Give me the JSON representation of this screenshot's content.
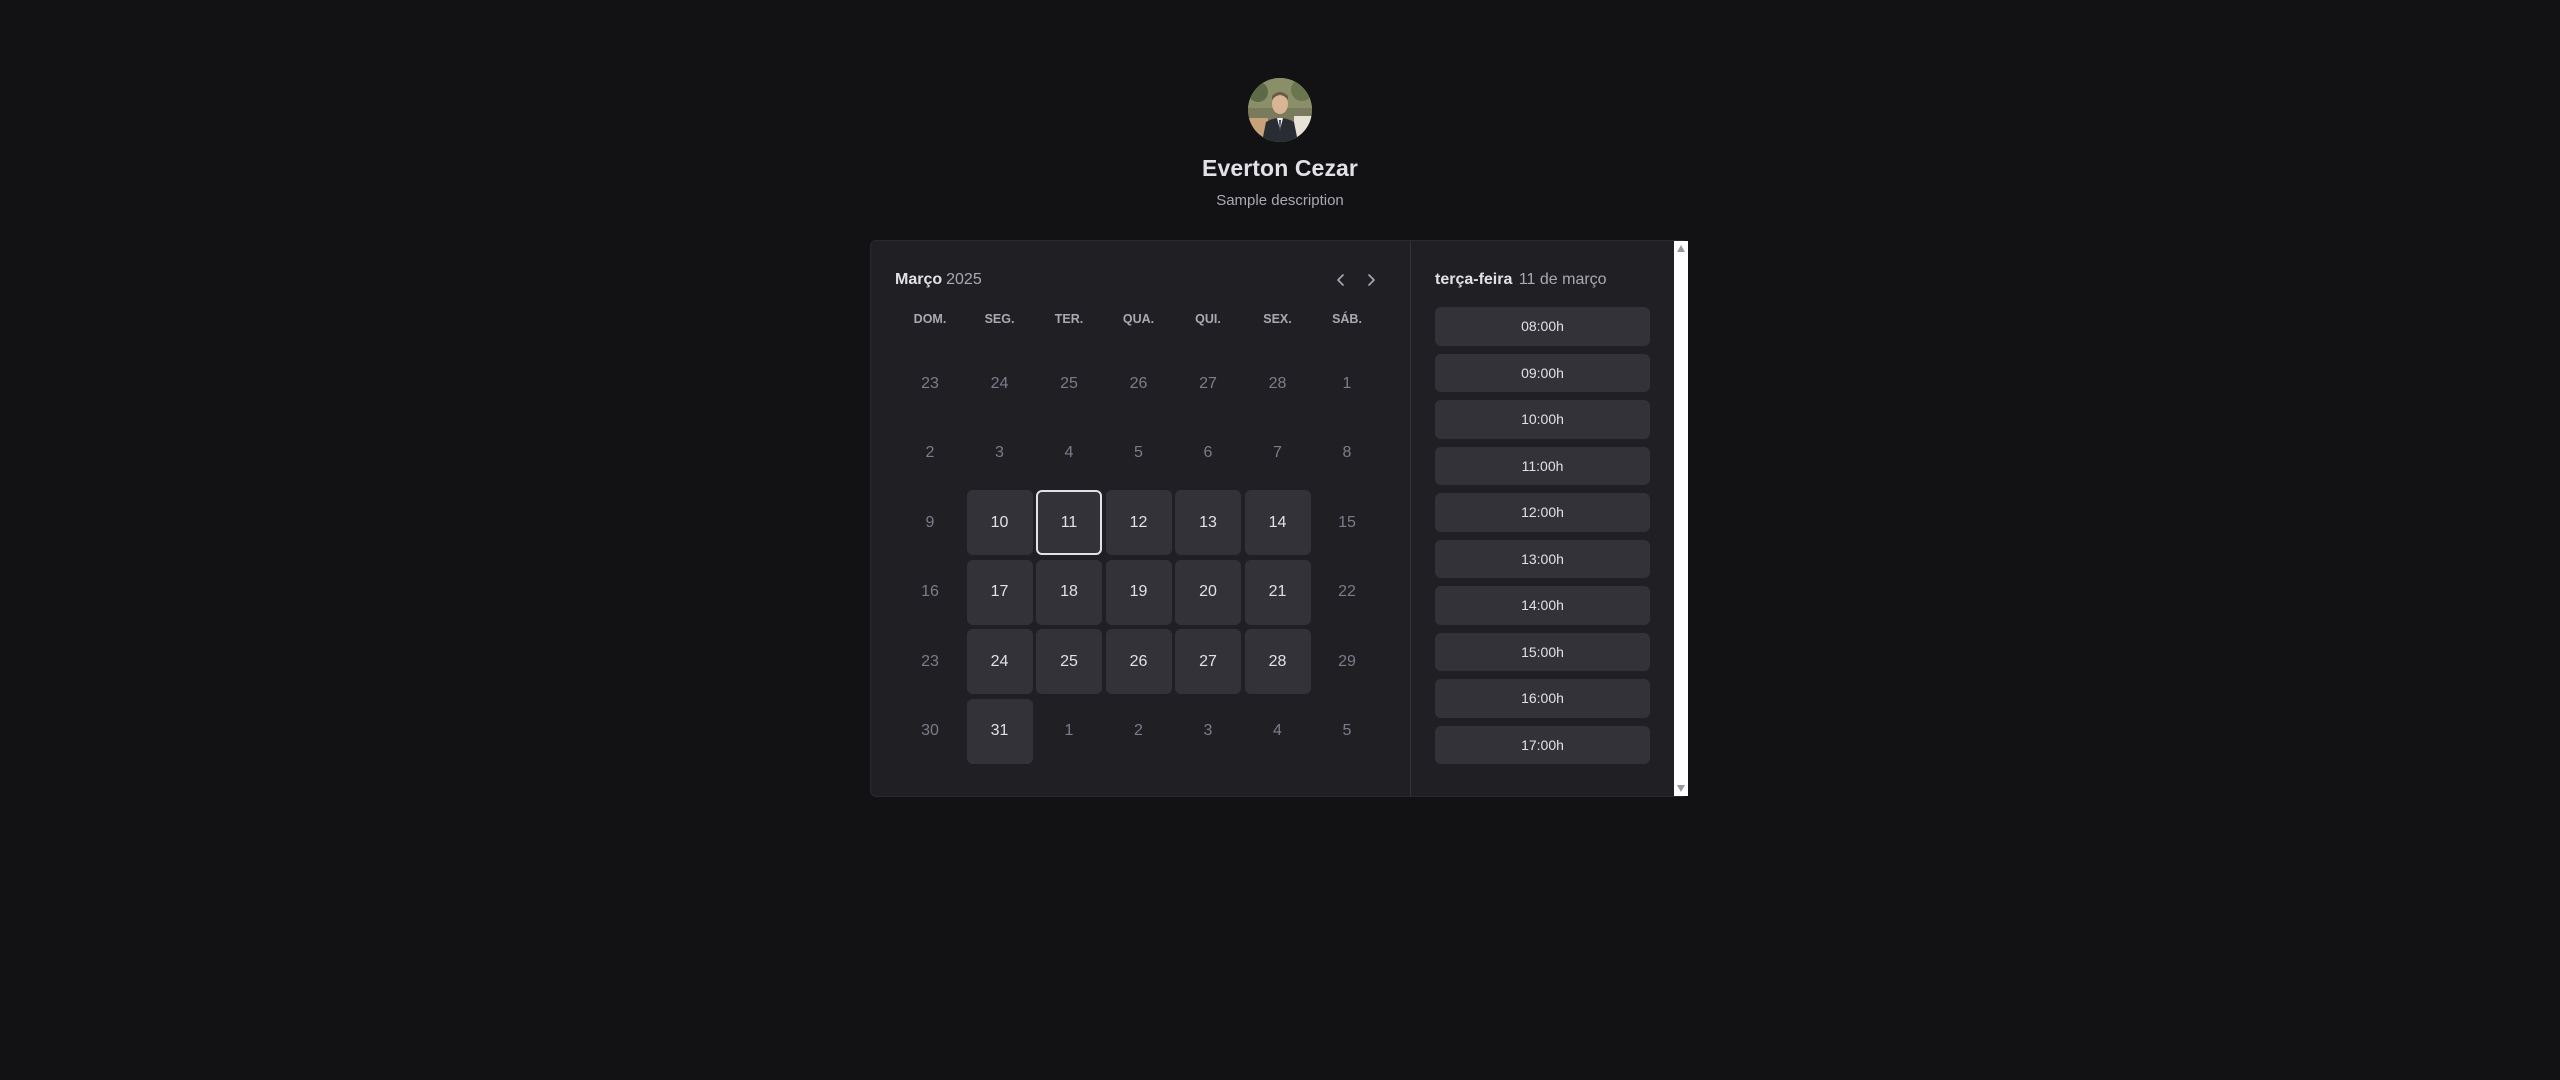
{
  "profile": {
    "name": "Everton Cezar",
    "description": "Sample description"
  },
  "calendar": {
    "month": "Março",
    "year": "2025",
    "weekdays": [
      "DOM.",
      "SEG.",
      "TER.",
      "QUA.",
      "QUI.",
      "SEX.",
      "SÁB."
    ],
    "weeks": [
      [
        {
          "day": "23",
          "available": false
        },
        {
          "day": "24",
          "available": false
        },
        {
          "day": "25",
          "available": false
        },
        {
          "day": "26",
          "available": false
        },
        {
          "day": "27",
          "available": false
        },
        {
          "day": "28",
          "available": false
        },
        {
          "day": "1",
          "available": false
        }
      ],
      [
        {
          "day": "2",
          "available": false
        },
        {
          "day": "3",
          "available": false
        },
        {
          "day": "4",
          "available": false
        },
        {
          "day": "5",
          "available": false
        },
        {
          "day": "6",
          "available": false
        },
        {
          "day": "7",
          "available": false
        },
        {
          "day": "8",
          "available": false
        }
      ],
      [
        {
          "day": "9",
          "available": false
        },
        {
          "day": "10",
          "available": true
        },
        {
          "day": "11",
          "available": true,
          "selected": true
        },
        {
          "day": "12",
          "available": true
        },
        {
          "day": "13",
          "available": true
        },
        {
          "day": "14",
          "available": true
        },
        {
          "day": "15",
          "available": false
        }
      ],
      [
        {
          "day": "16",
          "available": false
        },
        {
          "day": "17",
          "available": true
        },
        {
          "day": "18",
          "available": true
        },
        {
          "day": "19",
          "available": true
        },
        {
          "day": "20",
          "available": true
        },
        {
          "day": "21",
          "available": true
        },
        {
          "day": "22",
          "available": false
        }
      ],
      [
        {
          "day": "23",
          "available": false
        },
        {
          "day": "24",
          "available": true
        },
        {
          "day": "25",
          "available": true
        },
        {
          "day": "26",
          "available": true
        },
        {
          "day": "27",
          "available": true
        },
        {
          "day": "28",
          "available": true
        },
        {
          "day": "29",
          "available": false
        }
      ],
      [
        {
          "day": "30",
          "available": false
        },
        {
          "day": "31",
          "available": true
        },
        {
          "day": "1",
          "available": false
        },
        {
          "day": "2",
          "available": false
        },
        {
          "day": "3",
          "available": false
        },
        {
          "day": "4",
          "available": false
        },
        {
          "day": "5",
          "available": false
        }
      ]
    ],
    "prev_icon": "chevron-left-icon",
    "next_icon": "chevron-right-icon"
  },
  "timepicker": {
    "weekday": "terça-feira",
    "date": "11 de março",
    "times": [
      "08:00h",
      "09:00h",
      "10:00h",
      "11:00h",
      "12:00h",
      "13:00h",
      "14:00h",
      "15:00h",
      "16:00h",
      "17:00h"
    ]
  },
  "colors": {
    "background": "#121214",
    "panel": "#202024",
    "slot": "#323238",
    "text": "#e1e1e6",
    "muted": "#7c7c8a"
  }
}
